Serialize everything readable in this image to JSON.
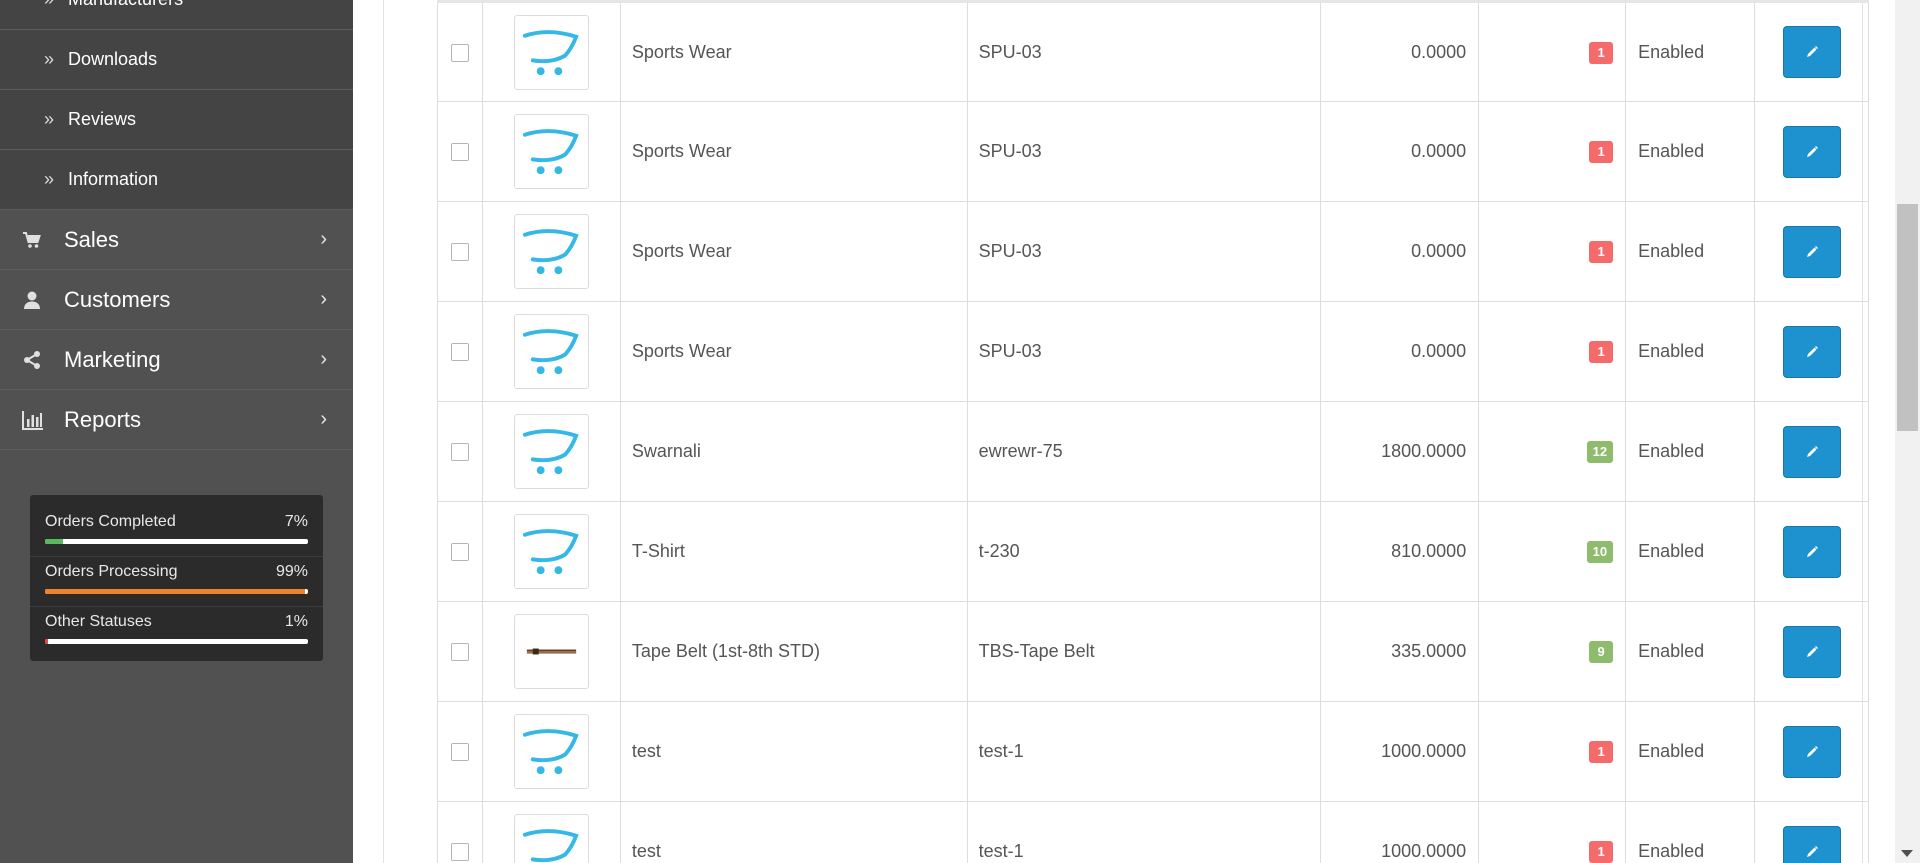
{
  "sidebar": {
    "sub_items": [
      {
        "label": "Manufacturers"
      },
      {
        "label": "Downloads"
      },
      {
        "label": "Reviews"
      },
      {
        "label": "Information"
      }
    ],
    "main_items": [
      {
        "label": "Sales",
        "icon": "shopping-cart-icon"
      },
      {
        "label": "Customers",
        "icon": "user-icon"
      },
      {
        "label": "Marketing",
        "icon": "share-icon"
      },
      {
        "label": "Reports",
        "icon": "bar-chart-icon"
      }
    ],
    "chevron_glyph": "»",
    "arrow_glyph": "›"
  },
  "order_status": [
    {
      "label": "Orders Completed",
      "percent": "7%",
      "value": 7,
      "color": "#5cb85c"
    },
    {
      "label": "Orders Processing",
      "percent": "99%",
      "value": 99,
      "color": "#f0812d"
    },
    {
      "label": "Other Statuses",
      "percent": "1%",
      "value": 1,
      "color": "#e34a4a"
    }
  ],
  "products": [
    {
      "name": "Sports Wear",
      "model": "SPU-03",
      "price": "0.0000",
      "quantity": "1",
      "qty_level": "low",
      "status": "Enabled",
      "image": "opencart-cart-icon"
    },
    {
      "name": "Sports Wear",
      "model": "SPU-03",
      "price": "0.0000",
      "quantity": "1",
      "qty_level": "low",
      "status": "Enabled",
      "image": "opencart-cart-icon"
    },
    {
      "name": "Sports Wear",
      "model": "SPU-03",
      "price": "0.0000",
      "quantity": "1",
      "qty_level": "low",
      "status": "Enabled",
      "image": "opencart-cart-icon"
    },
    {
      "name": "Sports Wear",
      "model": "SPU-03",
      "price": "0.0000",
      "quantity": "1",
      "qty_level": "low",
      "status": "Enabled",
      "image": "opencart-cart-icon"
    },
    {
      "name": "Swarnali",
      "model": "ewrewr-75",
      "price": "1800.0000",
      "quantity": "12",
      "qty_level": "ok",
      "status": "Enabled",
      "image": "opencart-cart-icon"
    },
    {
      "name": "T-Shirt",
      "model": "t-230",
      "price": "810.0000",
      "quantity": "10",
      "qty_level": "ok",
      "status": "Enabled",
      "image": "opencart-cart-icon"
    },
    {
      "name": "Tape Belt (1st-8th STD)",
      "model": "TBS-Tape Belt",
      "price": "335.0000",
      "quantity": "9",
      "qty_level": "ok",
      "status": "Enabled",
      "image": "tape-belt-photo"
    },
    {
      "name": "test",
      "model": "test-1",
      "price": "1000.0000",
      "quantity": "1",
      "qty_level": "low",
      "status": "Enabled",
      "image": "opencart-cart-icon"
    },
    {
      "name": "test",
      "model": "test-1",
      "price": "1000.0000",
      "quantity": "1",
      "qty_level": "low",
      "status": "Enabled",
      "image": "opencart-cart-icon"
    }
  ],
  "colors": {
    "sidebar_bg": "#515151",
    "sidebar_sub_bg": "#444444",
    "edit_button": "#1e91cf",
    "badge_low": "#f56b6b",
    "badge_ok": "#8fbb6c"
  }
}
